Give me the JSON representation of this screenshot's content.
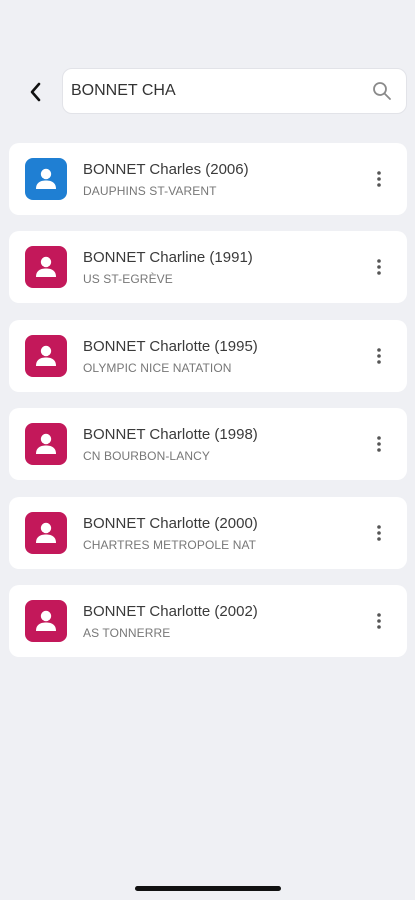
{
  "header": {
    "back_icon": "chevron-left-icon",
    "search": {
      "value": "BONNET CHA",
      "icon": "search-icon"
    }
  },
  "results": [
    {
      "name": "BONNET Charles (2006)",
      "club": "DAUPHINS ST-VARENT",
      "avatar_color": "#1f7fd3",
      "icon": "person-icon"
    },
    {
      "name": "BONNET Charline (1991)",
      "club": "US ST-EGRÈVE",
      "avatar_color": "#c3185a",
      "icon": "person-icon"
    },
    {
      "name": "BONNET Charlotte (1995)",
      "club": "OLYMPIC NICE NATATION",
      "avatar_color": "#c3185a",
      "icon": "person-icon"
    },
    {
      "name": "BONNET Charlotte (1998)",
      "club": "CN BOURBON-LANCY",
      "avatar_color": "#c3185a",
      "icon": "person-icon"
    },
    {
      "name": "BONNET Charlotte (2000)",
      "club": "CHARTRES METROPOLE NAT",
      "avatar_color": "#c3185a",
      "icon": "person-icon"
    },
    {
      "name": "BONNET Charlotte (2002)",
      "club": "AS TONNERRE",
      "avatar_color": "#c3185a",
      "icon": "person-icon"
    }
  ],
  "colors": {
    "background": "#eff0f4",
    "card": "#ffffff",
    "male_accent": "#1f7fd3",
    "female_accent": "#c3185a"
  }
}
